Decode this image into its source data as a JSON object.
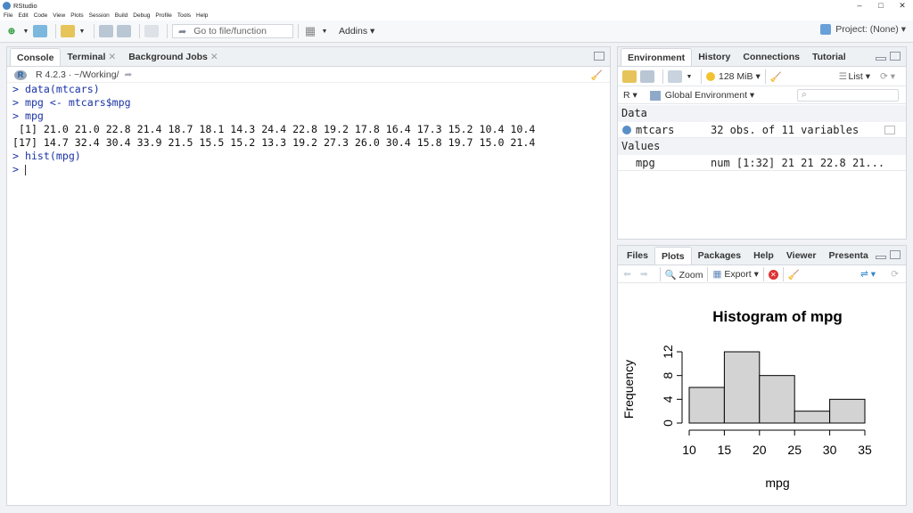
{
  "window": {
    "title": "RStudio"
  },
  "menu": [
    "File",
    "Edit",
    "Code",
    "View",
    "Plots",
    "Session",
    "Build",
    "Debug",
    "Profile",
    "Tools",
    "Help"
  ],
  "toolbar": {
    "goto_placeholder": "Go to file/function",
    "addins": "Addins",
    "project": "Project: (None)"
  },
  "left_pane": {
    "tabs": [
      "Console",
      "Terminal",
      "Background Jobs"
    ],
    "path": "R 4.2.3 · ~/Working/",
    "lines": [
      {
        "kind": "cmd",
        "text": "> data(mtcars)"
      },
      {
        "kind": "cmd",
        "text": "> mpg <- mtcars$mpg"
      },
      {
        "kind": "cmd",
        "text": "> mpg"
      },
      {
        "kind": "out",
        "text": " [1] 21.0 21.0 22.8 21.4 18.7 18.1 14.3 24.4 22.8 19.2 17.8 16.4 17.3 15.2 10.4 10.4"
      },
      {
        "kind": "out",
        "text": "[17] 14.7 32.4 30.4 33.9 21.5 15.5 15.2 13.3 19.2 27.3 26.0 30.4 15.8 19.7 15.0 21.4"
      },
      {
        "kind": "cmd",
        "text": "> hist(mpg)"
      }
    ],
    "prompt": ">"
  },
  "env_pane": {
    "tabs": [
      "Environment",
      "History",
      "Connections",
      "Tutorial"
    ],
    "memory": "128 MiB",
    "view_mode": "List",
    "lang": "R",
    "scope": "Global Environment",
    "section_data": "Data",
    "section_values": "Values",
    "data_rows": [
      {
        "name": "mtcars",
        "value": "32 obs. of 11 variables"
      }
    ],
    "value_rows": [
      {
        "name": "mpg",
        "value": "num [1:32] 21 21 22.8 21..."
      }
    ]
  },
  "plots_pane": {
    "tabs": [
      "Files",
      "Plots",
      "Packages",
      "Help",
      "Viewer",
      "Presenta"
    ],
    "zoom_label": "Zoom",
    "export_label": "Export"
  },
  "chart_data": {
    "type": "bar",
    "title": "Histogram of mpg",
    "xlabel": "mpg",
    "ylabel": "Frequency",
    "bins": [
      [
        10,
        15
      ],
      [
        15,
        20
      ],
      [
        20,
        25
      ],
      [
        25,
        30
      ],
      [
        30,
        35
      ]
    ],
    "values": [
      6,
      12,
      8,
      2,
      4
    ],
    "xticks": [
      "10",
      "15",
      "20",
      "25",
      "30",
      "35"
    ],
    "yticks": [
      "0",
      "4",
      "8",
      "12"
    ],
    "xlim": [
      10,
      35
    ],
    "ylim": [
      0,
      12
    ],
    "bar_color": "#d3d3d3"
  }
}
